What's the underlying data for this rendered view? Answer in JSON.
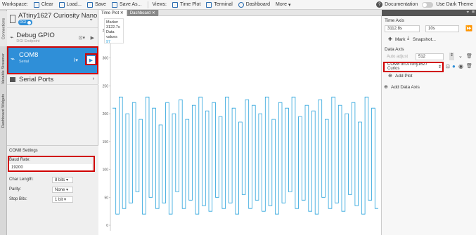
{
  "toolbar": {
    "workspace_label": "Workspace:",
    "clear_label": "Clear",
    "load_label": "Load...",
    "save_label": "Save",
    "save_as_label": "Save As...",
    "views_label": "Views:",
    "time_plot_label": "Time Plot",
    "terminal_label": "Terminal",
    "dashboard_label": "Dashboard",
    "more_label": "More",
    "documentation_label": "Documentation",
    "dark_theme_label": "Use Dark Theme"
  },
  "vertical_tabs": [
    "Connections",
    "Variable Streamer",
    "Dashboard Widgets"
  ],
  "sidebar": {
    "devices": [
      {
        "name": "ATtiny1627 Curiosity Nano",
        "badge": "DGI"
      },
      {
        "name": "Debug GPIO",
        "sub": "DGI Endpoint"
      },
      {
        "name": "COM8",
        "sub": "Serial"
      },
      {
        "name": "Serial Ports"
      }
    ],
    "settings": {
      "title": "COM8 Settings",
      "baud_label": "Baud Rate:",
      "baud_value": "19200",
      "char_length_label": "Char Length:",
      "char_length_value": "8 bits",
      "parity_label": "Parity:",
      "parity_value": "None",
      "stop_bits_label": "Stop Bits:",
      "stop_bits_value": "1 bit"
    }
  },
  "tabs": [
    {
      "label": "Time Plot",
      "active": true
    },
    {
      "label": "Dashboard",
      "active": false
    }
  ],
  "marker_box": {
    "title": "Marker",
    "value": "3122.7s",
    "data_values_label": "Data values",
    "data_value": "97"
  },
  "chart_data": {
    "type": "line",
    "y_ticks": [
      0,
      50,
      100,
      150,
      200,
      250,
      300,
      350
    ],
    "ylim": [
      -10,
      370
    ],
    "series": [
      {
        "color": "#2aa3dc",
        "values": [
          210,
          20,
          230,
          30,
          200,
          40,
          220,
          60,
          190,
          20,
          230,
          50,
          210,
          30,
          180,
          40,
          220,
          20,
          200,
          60,
          225,
          30,
          190,
          45,
          215,
          20,
          230,
          35,
          205,
          25,
          220,
          50,
          195,
          30,
          230,
          40,
          210,
          20,
          185,
          55,
          225,
          30,
          215,
          45,
          200,
          25,
          230,
          35,
          190,
          20,
          220,
          40,
          210,
          60,
          230,
          30,
          195,
          45,
          215,
          25,
          205,
          20,
          225,
          50,
          190,
          30,
          230,
          40,
          215,
          25,
          200,
          55,
          220,
          35,
          185,
          20,
          230,
          45,
          210,
          30
        ]
      }
    ]
  },
  "right_panel": {
    "time_axis_label": "Time Axis",
    "time_axis_value": "3112.8s",
    "time_axis_span": "10s",
    "mark_label": "Mark",
    "snapshot_label": "Snapshot...",
    "data_axis_label": "Data Axis",
    "auto_adjust_label": "Auto adjust",
    "data_axis_value": "512",
    "source_select": "COM8 on ATtiny1627 Curios",
    "add_plot_label": "Add Plot",
    "add_data_axis_label": "Add Data Axis"
  },
  "colors": {
    "accent": "#2f8fd8",
    "highlight_box": "#d00000",
    "plot_line": "#2aa3dc"
  }
}
